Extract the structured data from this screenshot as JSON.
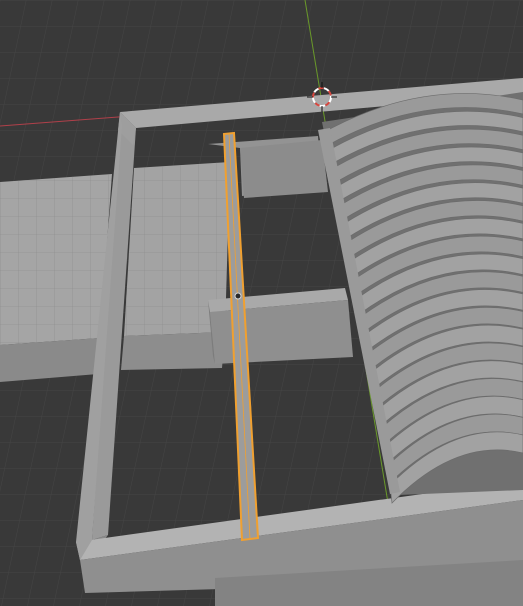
{
  "viewport": {
    "colors": {
      "background": "#393939",
      "grid_line": "#454545",
      "x_axis": "#b0404a",
      "y_axis": "#6a9a2a",
      "mesh_light": "#a3a3a3",
      "mesh_mid": "#8f8f8f",
      "mesh_dark": "#777777",
      "mesh_edge": "#5c5c5c",
      "selection": "#f0a030",
      "cursor_red": "#d8463e",
      "cursor_white": "#ffffff"
    },
    "selected_object": "plank",
    "icons": {
      "cursor": "3d-cursor-icon",
      "origin": "object-origin-icon"
    }
  }
}
